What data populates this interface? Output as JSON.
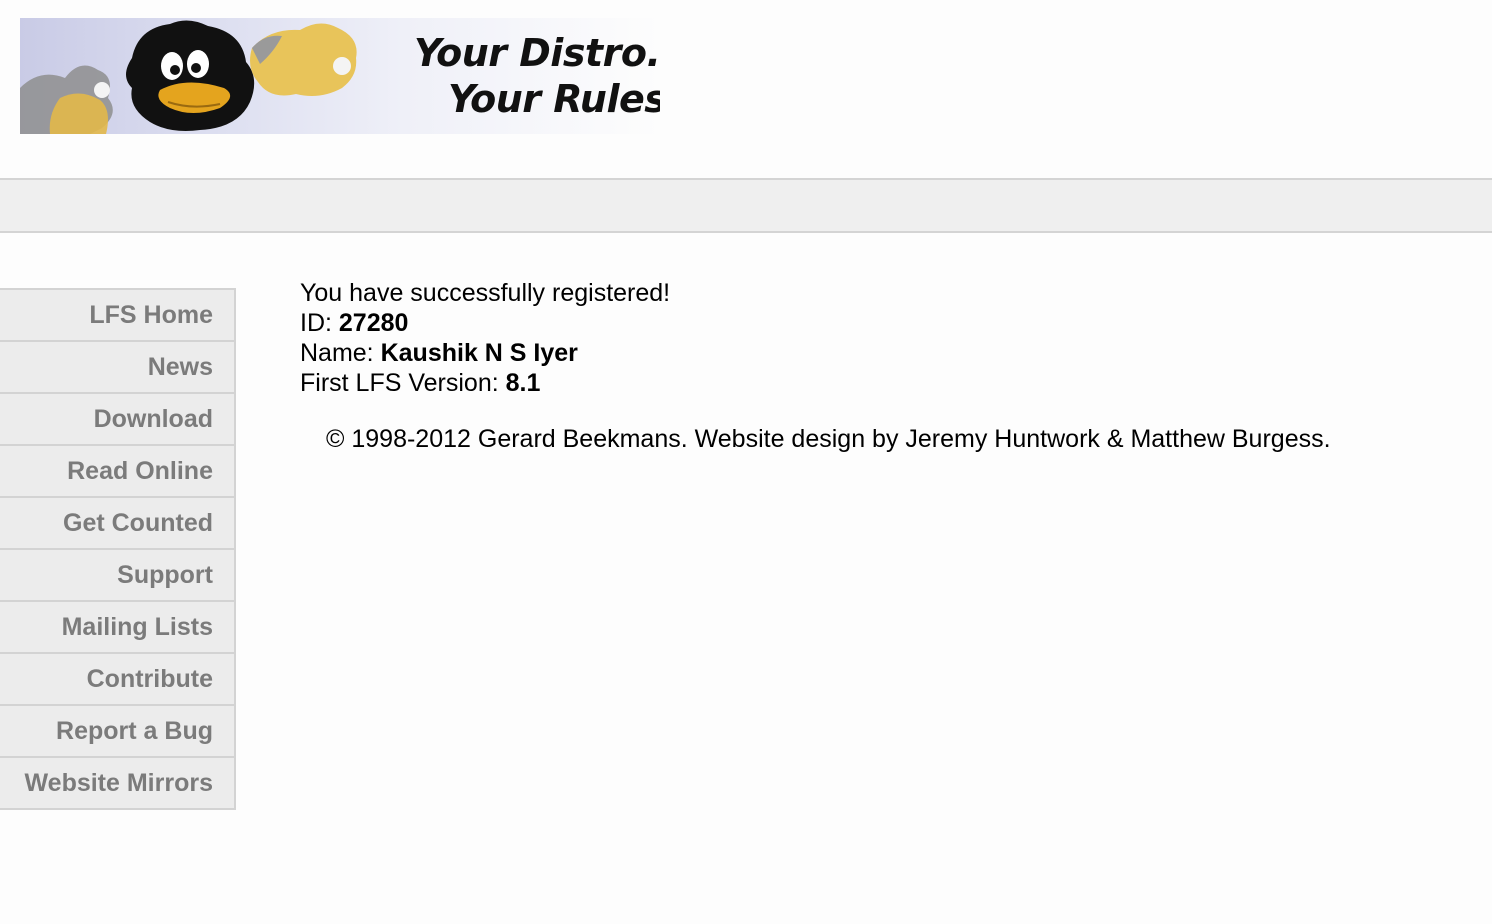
{
  "banner": {
    "tagline_line1": "Your Distro.",
    "tagline_line2": "Your Rules."
  },
  "sidebar": {
    "items": [
      {
        "label": "LFS Home"
      },
      {
        "label": "News"
      },
      {
        "label": "Download"
      },
      {
        "label": "Read Online"
      },
      {
        "label": "Get Counted"
      },
      {
        "label": "Support"
      },
      {
        "label": "Mailing Lists"
      },
      {
        "label": "Contribute"
      },
      {
        "label": "Report a Bug"
      },
      {
        "label": "Website Mirrors"
      }
    ]
  },
  "registration": {
    "message": "You have successfully registered!",
    "id_label": "ID: ",
    "id_value": "27280",
    "name_label": "Name: ",
    "name_value": "Kaushik N S Iyer",
    "version_label": "First LFS Version: ",
    "version_value": "8.1"
  },
  "footer": {
    "copyright": "© 1998-2012 Gerard Beekmans. Website design by Jeremy Huntwork & Matthew Burgess."
  },
  "colors": {
    "nav_text": "#7b7b7b",
    "nav_bg": "#ececec",
    "bar_bg": "#efefef",
    "border": "#d3d3d3"
  }
}
